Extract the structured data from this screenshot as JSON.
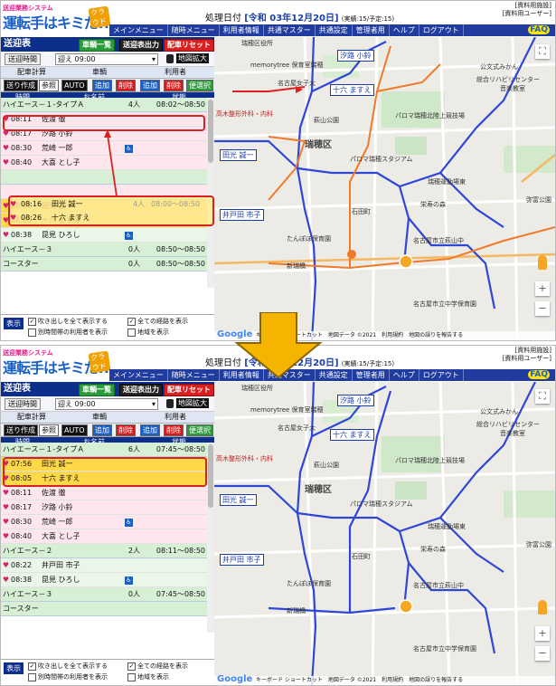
{
  "header": {
    "logo_small": "送迎業務システム",
    "logo_main": "運転手はキミだ!!",
    "logo_tag": "クラウド",
    "proc_label": "処理日付",
    "proc_date": "[令和 03年12月20日]",
    "proc_count": "(実績:15/予定:15)",
    "user_facility": "[資料用施設]",
    "user_name": "[資料用ユーザー]",
    "faq": "FAQ",
    "menu": [
      "メインメニュー",
      "随時メニュー",
      "利用者情報",
      "共通マスター",
      "共通設定",
      "管理者用",
      "ヘルプ",
      "ログアウト"
    ]
  },
  "left": {
    "title": "送迎表",
    "btn_vehicle_list": "車輌一覧",
    "btn_output": "送迎表出力",
    "btn_reset": "配車リセット",
    "time_label": "送迎時間",
    "time_value": "迎え 09:00",
    "map_zoom": "地図拡大",
    "group_calc": "配車計算",
    "group_vehicle": "車輌",
    "group_user": "利用者",
    "act_create": "送り作成",
    "act_ref": "参照",
    "act_auto": "AUTO",
    "act_add": "追加",
    "act_del": "削除",
    "act_select": "便選択",
    "col_time": "時間",
    "col_name": "お名前",
    "col_status": "状態",
    "footer": {
      "display": "表示",
      "opt1": "吹き出しを全て表示する",
      "opt2": "全ての経路を表示",
      "opt3": "別時間帯の利用者を表示",
      "opt4": "地域を表示"
    }
  },
  "before": {
    "rows": [
      {
        "kind": "vehicle",
        "name": "ハイエース－１-タイプＡ",
        "count": "4人",
        "status": "08:02～08:50"
      },
      {
        "kind": "person",
        "bg": "pink",
        "time": "08:11",
        "name": "佐渡 徹",
        "wc": false
      },
      {
        "kind": "person",
        "bg": "pink",
        "time": "08:17",
        "name": "汐路 小鈴",
        "wc": false
      },
      {
        "kind": "person",
        "bg": "pink",
        "time": "08:30",
        "name": "荒崎 一郎",
        "wc": true
      },
      {
        "kind": "person",
        "bg": "pink",
        "time": "08:40",
        "name": "大喜 とし子",
        "wc": false
      },
      {
        "kind": "vehicle",
        "name": "",
        "count": "",
        "status": ""
      },
      {
        "kind": "person",
        "bg": "pink",
        "time": "",
        "name": "",
        "wc": false
      },
      {
        "kind": "person",
        "bg": "yellow",
        "time": "08:16",
        "name": "田光 誠一",
        "wc": false
      },
      {
        "kind": "person",
        "bg": "yellow",
        "time": "08:26",
        "name": "十六 ますえ",
        "wc": false
      },
      {
        "kind": "person",
        "bg": "lgreen",
        "time": "08:38",
        "name": "昆見 ひろし",
        "wc": true
      },
      {
        "kind": "vehicle",
        "name": "ハイエース－３",
        "count": "0人",
        "status": "08:50～08:50"
      },
      {
        "kind": "vehicle",
        "name": "コースター",
        "count": "0人",
        "status": "08:50～08:50"
      }
    ],
    "ghost": [
      {
        "time": "08:16",
        "name": "田光 誠一",
        "count": "4人",
        "status": "08:00～08:50"
      },
      {
        "time": "08:26",
        "name": "十六 ますえ"
      }
    ]
  },
  "after": {
    "rows": [
      {
        "kind": "vehicle",
        "name": "ハイエース－１-タイプＡ",
        "count": "6人",
        "status": "07:45～08:50"
      },
      {
        "kind": "person",
        "bg": "yellow",
        "time": "07:56",
        "name": "田光 誠一",
        "wc": false
      },
      {
        "kind": "person",
        "bg": "yellow",
        "time": "08:05",
        "name": "十六 ますえ",
        "wc": false
      },
      {
        "kind": "person",
        "bg": "pink",
        "time": "08:11",
        "name": "佐渡 徹",
        "wc": false
      },
      {
        "kind": "person",
        "bg": "pink",
        "time": "08:17",
        "name": "汐路 小鈴",
        "wc": false
      },
      {
        "kind": "person",
        "bg": "pink",
        "time": "08:30",
        "name": "荒崎 一郎",
        "wc": true
      },
      {
        "kind": "person",
        "bg": "pink",
        "time": "08:40",
        "name": "大喜 とし子",
        "wc": false
      },
      {
        "kind": "vehicle",
        "name": "ハイエース－２",
        "count": "2人",
        "status": "08:11～08:50"
      },
      {
        "kind": "person",
        "bg": "lgreen",
        "time": "08:22",
        "name": "井戸田 市子",
        "wc": false
      },
      {
        "kind": "person",
        "bg": "lgreen",
        "time": "08:38",
        "name": "昆見 ひろし",
        "wc": true
      },
      {
        "kind": "vehicle",
        "name": "ハイエース－３",
        "count": "0人",
        "status": "07:45～08:50"
      },
      {
        "kind": "vehicle",
        "name": "コースター",
        "count": "",
        "status": ""
      }
    ]
  },
  "map": {
    "ward": "瑞穂区",
    "labels": [
      "名古屋女子大",
      "萩山公園",
      "高木整形外科・内科",
      "パロマ瑞穂北陸上競技場",
      "パロマ瑞穂スタジアム",
      "瑞穂運動場東",
      "栄寿の森",
      "総合リハビリセンター",
      "名古屋市立萩山中",
      "石田町",
      "たんぽぽ保育園",
      "名古屋市立中学保育園",
      "新瑞橋",
      "弥富公園",
      "公文式みかん",
      "音楽教室",
      "瑞穂区役所",
      "memorytree 保育室瑞穂"
    ],
    "callouts_before": [
      "汐路 小鈴",
      "十六 ますえ",
      "田光 誠一",
      "井戸田 市子"
    ],
    "callouts_after": [
      "汐路 小鈴",
      "十六 ますえ",
      "田光 誠一",
      "井戸田 市子"
    ],
    "footer": "キーボード ショートカット　地図データ ©2021　利用規約　地図の誤りを報告する",
    "google": "Google",
    "route_colors": {
      "blue": "#2f46d6",
      "orange": "#f07a2a",
      "red": "#e02020"
    }
  }
}
